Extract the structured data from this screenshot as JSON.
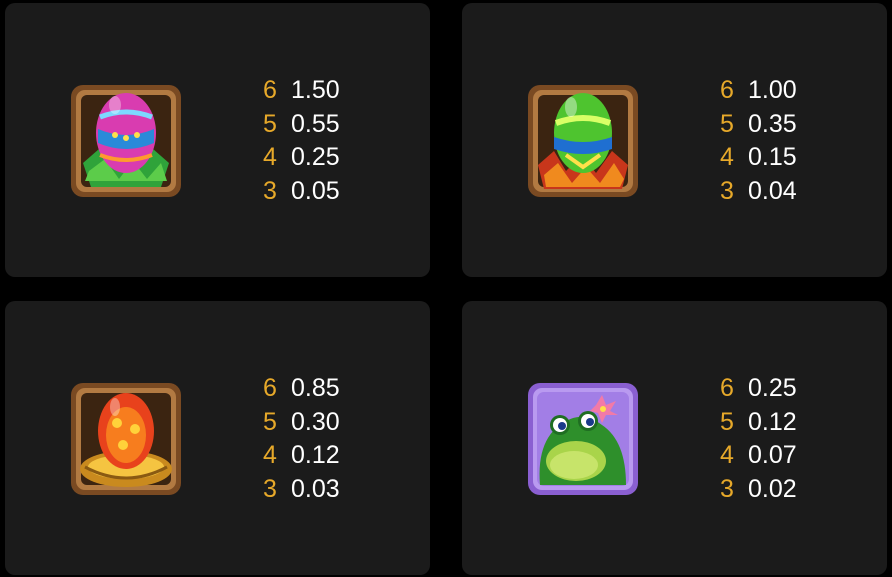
{
  "colors": {
    "background": "#000000",
    "card": "#1b1b1b",
    "count": "#e7a92a",
    "payout": "#ffffff"
  },
  "cards": [
    {
      "symbol_icon": "pink-egg-on-leaves-icon",
      "rows": [
        {
          "count": "6",
          "payout": "1.50"
        },
        {
          "count": "5",
          "payout": "0.55"
        },
        {
          "count": "4",
          "payout": "0.25"
        },
        {
          "count": "3",
          "payout": "0.05"
        }
      ]
    },
    {
      "symbol_icon": "green-egg-on-autumn-leaves-icon",
      "rows": [
        {
          "count": "6",
          "payout": "1.00"
        },
        {
          "count": "5",
          "payout": "0.35"
        },
        {
          "count": "4",
          "payout": "0.15"
        },
        {
          "count": "3",
          "payout": "0.04"
        }
      ]
    },
    {
      "symbol_icon": "orange-egg-in-nest-icon",
      "rows": [
        {
          "count": "6",
          "payout": "0.85"
        },
        {
          "count": "5",
          "payout": "0.30"
        },
        {
          "count": "4",
          "payout": "0.12"
        },
        {
          "count": "3",
          "payout": "0.03"
        }
      ]
    },
    {
      "symbol_icon": "frog-icon",
      "rows": [
        {
          "count": "6",
          "payout": "0.25"
        },
        {
          "count": "5",
          "payout": "0.12"
        },
        {
          "count": "4",
          "payout": "0.07"
        },
        {
          "count": "3",
          "payout": "0.02"
        }
      ]
    }
  ]
}
